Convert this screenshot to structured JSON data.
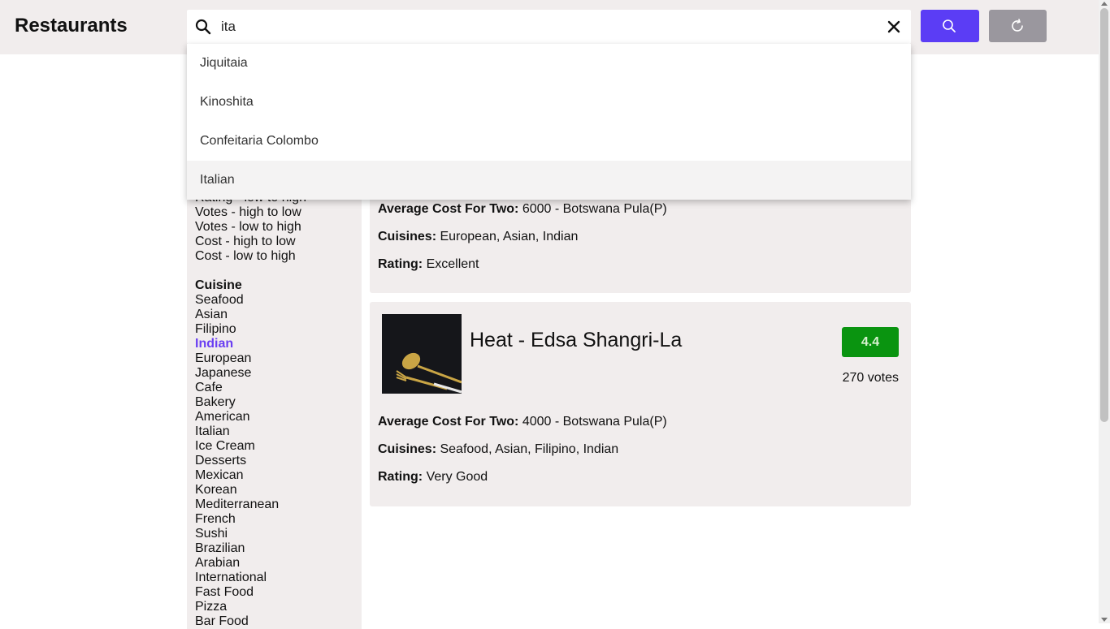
{
  "header": {
    "title": "Restaurants",
    "search": {
      "value": "ita",
      "placeholder": ""
    },
    "search_button_icon": "search-icon",
    "refresh_button_icon": "refresh-icon"
  },
  "suggestions": [
    "Jiquitaia",
    "Kinoshita",
    "Confeitaria Colombo",
    "Italian"
  ],
  "sidebar": {
    "sort_options": [
      "Rating - low to high",
      "Votes - high to low",
      "Votes - low to high",
      "Cost - high to low",
      "Cost - low to high"
    ],
    "cuisine_title": "Cuisine",
    "cuisines": [
      "Seafood",
      "Asian",
      "Filipino",
      "Indian",
      "European",
      "Japanese",
      "Cafe",
      "Bakery",
      "American",
      "Italian",
      "Ice Cream",
      "Desserts",
      "Mexican",
      "Korean",
      "Mediterranean",
      "French",
      "Sushi",
      "Brazilian",
      "Arabian",
      "International",
      "Fast Food",
      "Pizza",
      "Bar Food"
    ],
    "selected_cuisine": "Indian"
  },
  "cards": [
    {
      "cost_label": "Average Cost For Two:",
      "cost": "6000 - Botswana Pula(P)",
      "cuisines_label": "Cuisines:",
      "cuisines": "European, Asian, Indian",
      "rating_label": "Rating:",
      "rating_text": "Excellent"
    },
    {
      "name": "Heat - Edsa Shangri-La",
      "rating": "4.4",
      "votes": "270 votes",
      "cost_label": "Average Cost For Two:",
      "cost": "4000 - Botswana Pula(P)",
      "cuisines_label": "Cuisines:",
      "cuisines": "Seafood, Asian, Filipino, Indian",
      "rating_label": "Rating:",
      "rating_text": "Very Good"
    }
  ],
  "colors": {
    "accent": "#5b3df5",
    "selected_text": "#6a3ff2",
    "rating_badge": "#0a9410",
    "panel_bg": "#f1eded"
  }
}
